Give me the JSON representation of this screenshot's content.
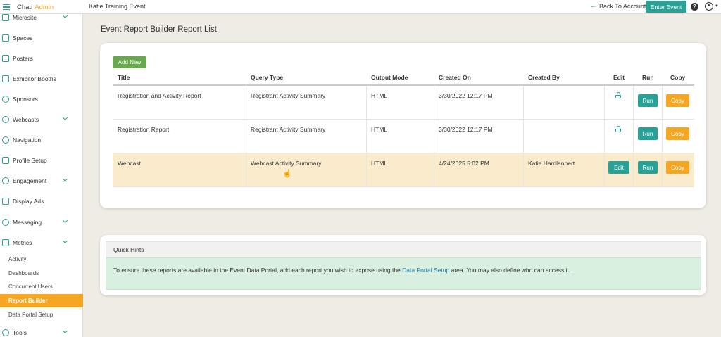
{
  "brand": {
    "part1": "Chati",
    "part2": "Admin"
  },
  "header": {
    "event_title": "Katie Training Event",
    "back_label": "Back To Account",
    "enter_label": "Enter Event",
    "help_glyph": "?"
  },
  "sidebar": {
    "items": [
      {
        "label": "Microsite",
        "icon": "microsite-icon",
        "chevron": true
      },
      {
        "label": "Spaces",
        "icon": "spaces-icon",
        "chevron": false
      },
      {
        "label": "Posters",
        "icon": "posters-icon",
        "chevron": false
      },
      {
        "label": "Exhibitor Booths",
        "icon": "booths-icon",
        "chevron": false
      },
      {
        "label": "Sponsors",
        "icon": "sponsors-icon",
        "chevron": false
      },
      {
        "label": "Webcasts",
        "icon": "webcasts-icon",
        "chevron": true
      },
      {
        "label": "Navigation",
        "icon": "navigation-icon",
        "chevron": false
      },
      {
        "label": "Profile Setup",
        "icon": "profile-setup-icon",
        "chevron": false
      },
      {
        "label": "Engagement",
        "icon": "engagement-icon",
        "chevron": true
      },
      {
        "label": "Display Ads",
        "icon": "display-ads-icon",
        "chevron": false
      },
      {
        "label": "Messaging",
        "icon": "messaging-icon",
        "chevron": true
      },
      {
        "label": "Metrics",
        "icon": "metrics-icon",
        "chevron": true
      }
    ],
    "subitems": [
      "Activity",
      "Dashboards",
      "Concurrent Users",
      "Report Builder",
      "Data Portal Setup"
    ],
    "tools_label": "Tools"
  },
  "page": {
    "title": "Event Report Builder Report List",
    "add_new_label": "Add New"
  },
  "table": {
    "headers": [
      "Title",
      "Query Type",
      "Output Mode",
      "Created On",
      "Created By",
      "Edit",
      "Run",
      "Copy"
    ],
    "rows": [
      {
        "title": "Registration and Activity Report",
        "query_type": "Registrant Activity Summary",
        "output_mode": "HTML",
        "created_on": "3/30/2022 12:17 PM",
        "created_by": "",
        "edit": "locked",
        "run_label": "Run",
        "copy_label": "Copy"
      },
      {
        "title": "Registration Report",
        "query_type": "Registrant Activity Summary",
        "output_mode": "HTML",
        "created_on": "3/30/2022 12:17 PM",
        "created_by": "",
        "edit": "locked",
        "run_label": "Run",
        "copy_label": "Copy"
      },
      {
        "title": "Webcast",
        "query_type": "Webcast Activity Summary",
        "output_mode": "HTML",
        "created_on": "4/24/2025 5:02 PM",
        "created_by": "Katie Hardlannert",
        "edit": "Edit",
        "run_label": "Run",
        "copy_label": "Copy"
      }
    ]
  },
  "hints": {
    "title": "Quick Hints",
    "text_before": "To ensure these reports are available in the Event Data Portal, add each report you wish to expose using the ",
    "link_text": "Data Portal Setup",
    "text_after": " area. You may also define who can access it."
  },
  "colors": {
    "teal": "#2aa197",
    "orange": "#f5a623",
    "green": "#6aa84f",
    "highlight_row": "#fbebcd",
    "hint_bg": "#d9efe0"
  }
}
